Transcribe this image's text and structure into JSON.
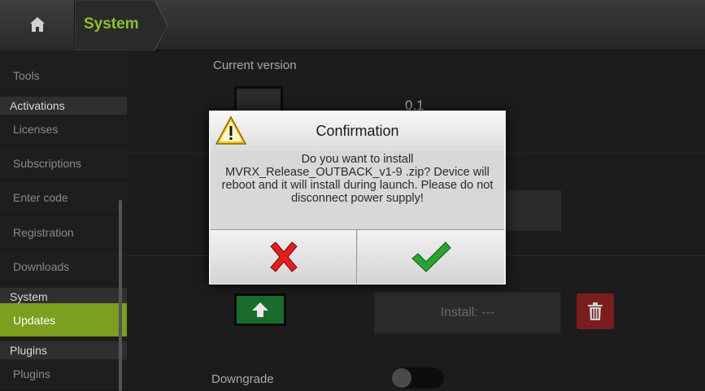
{
  "topbar": {
    "home_icon": "home-icon",
    "breadcrumb": "System"
  },
  "sidebar": {
    "items": [
      {
        "type": "item",
        "label": "Tools"
      },
      {
        "type": "header",
        "label": "Activations"
      },
      {
        "type": "item",
        "label": "Licenses"
      },
      {
        "type": "item",
        "label": "Subscriptions"
      },
      {
        "type": "item",
        "label": "Enter code"
      },
      {
        "type": "item",
        "label": "Registration"
      },
      {
        "type": "item",
        "label": "Downloads"
      },
      {
        "type": "header",
        "label": "System"
      },
      {
        "type": "item",
        "label": "Updates",
        "active": true
      },
      {
        "type": "header",
        "label": "Plugins"
      },
      {
        "type": "item",
        "label": "Plugins"
      }
    ]
  },
  "main": {
    "current_version_label": "Current version",
    "current_version_value": "0.1",
    "install_button": "Install: ---",
    "downgrade_label": "Downgrade",
    "downgrade_enabled": false
  },
  "dialog": {
    "title": "Confirmation",
    "message": "Do you want to install MVRX_Release_OUTBACK_v1-9    .zip? Device will reboot and it will install during launch. Please do not disconnect power supply!",
    "cancel_icon": "cross-icon",
    "confirm_icon": "checkmark-icon"
  },
  "colors": {
    "accent": "#7c9f20",
    "breadcrumb_text": "#8ec12a",
    "cancel": "#e02020",
    "confirm": "#2aa330",
    "delete": "#7a1d1d"
  }
}
